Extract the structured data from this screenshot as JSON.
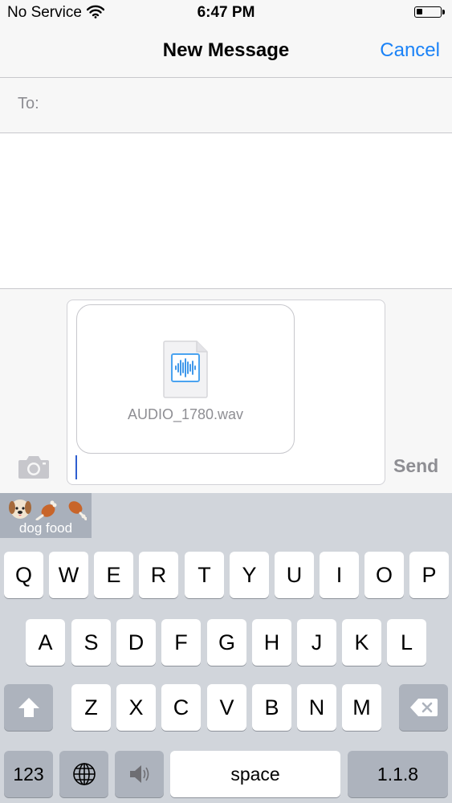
{
  "status_bar": {
    "carrier": "No Service",
    "time": "6:47 PM",
    "battery_level": 0.25
  },
  "nav": {
    "title": "New Message",
    "cancel_label": "Cancel"
  },
  "to_field": {
    "label": "To:",
    "value": ""
  },
  "compose": {
    "attachment": {
      "filename": "AUDIO_1780.wav",
      "icon": "audio-waveform-file-icon"
    },
    "message_text": "",
    "send_label": "Send",
    "camera_icon": "camera-icon"
  },
  "keyboard": {
    "suggestion": {
      "emoji_icons": [
        "dog-face-icon",
        "poultry-leg-icon",
        "poultry-leg-icon"
      ],
      "text": "dog food"
    },
    "row1": [
      "Q",
      "W",
      "E",
      "R",
      "T",
      "Y",
      "U",
      "I",
      "O",
      "P"
    ],
    "row2": [
      "A",
      "S",
      "D",
      "F",
      "G",
      "H",
      "J",
      "K",
      "L"
    ],
    "row3": [
      "Z",
      "X",
      "C",
      "V",
      "B",
      "N",
      "M"
    ],
    "numbers_label": "123",
    "space_label": "space",
    "version_label": "1.1.8",
    "icons": {
      "shift": "shift-icon",
      "delete": "delete-backspace-icon",
      "globe": "globe-icon",
      "dictation": "speaker-icon"
    }
  },
  "colors": {
    "accent": "#1a82f7",
    "keyboard_bg": "#d1d5db",
    "special_key": "#adb3bd",
    "cursor": "#2f5fd0"
  }
}
